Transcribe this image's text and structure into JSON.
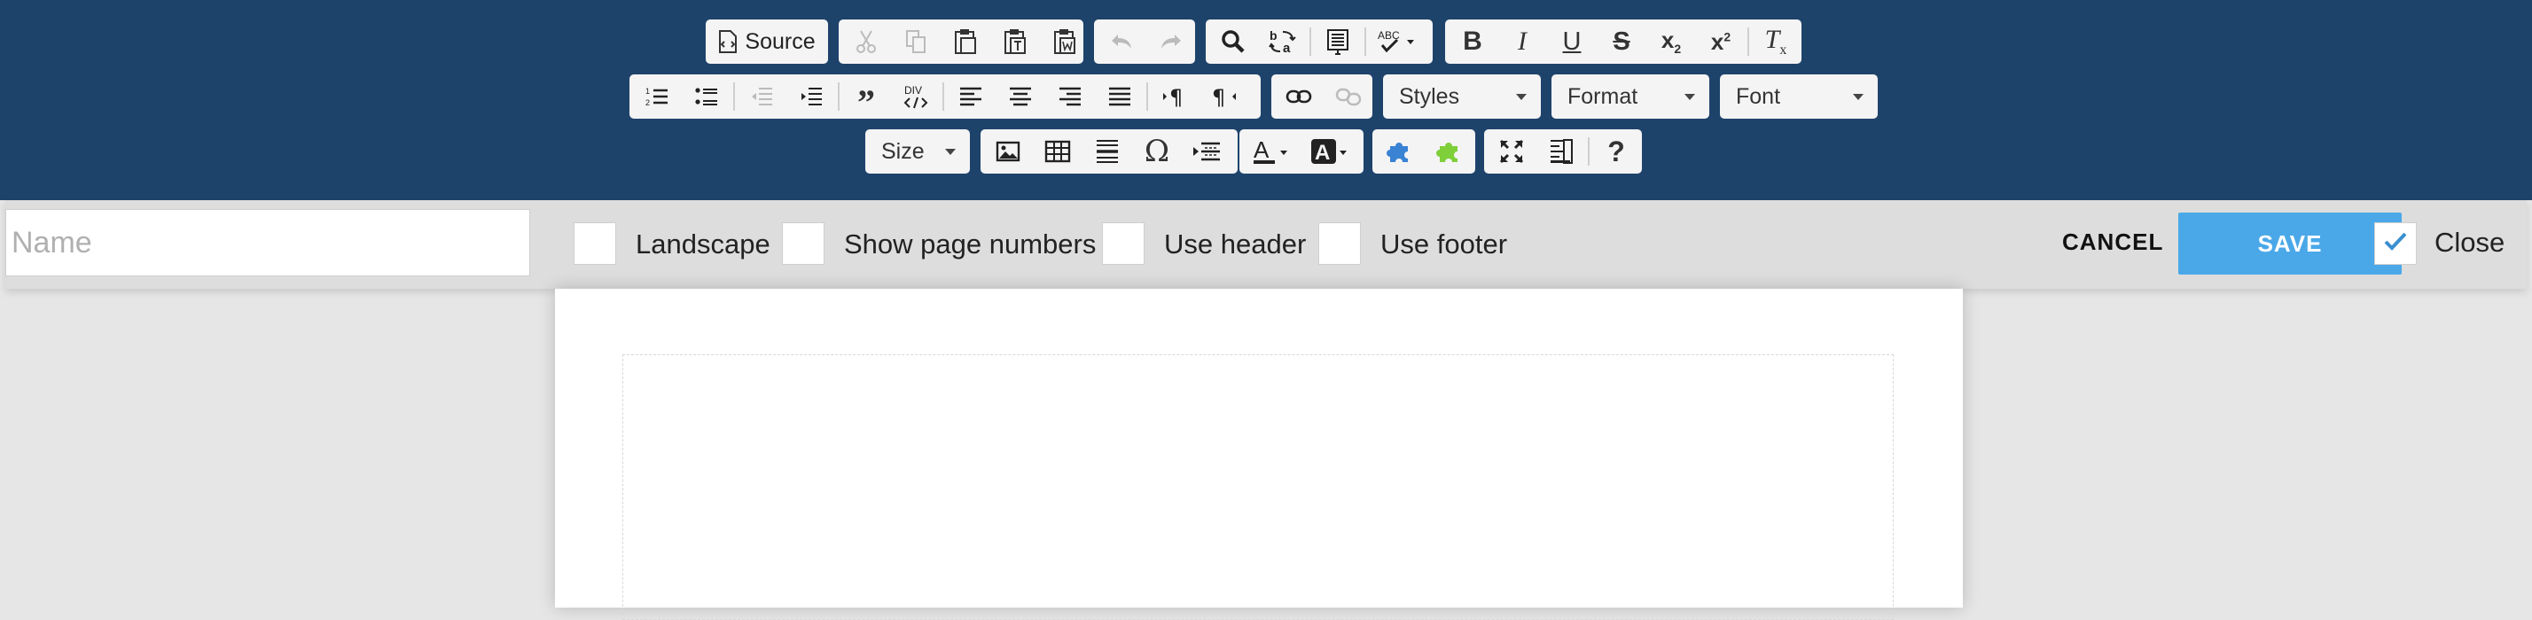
{
  "toolbar": {
    "source_label": "Source",
    "styles_label": "Styles",
    "format_label": "Format",
    "font_label": "Font",
    "size_label": "Size",
    "icons": [
      "source-icon",
      "cut-icon",
      "copy-icon",
      "paste-icon",
      "paste-text-icon",
      "paste-word-icon",
      "undo-icon",
      "redo-icon",
      "find-icon",
      "replace-icon",
      "select-all-icon",
      "spellcheck-icon",
      "bold-icon",
      "italic-icon",
      "underline-icon",
      "strikethrough-icon",
      "subscript-icon",
      "superscript-icon",
      "remove-format-icon",
      "numbered-list-icon",
      "bulleted-list-icon",
      "outdent-icon",
      "indent-icon",
      "blockquote-icon",
      "div-icon",
      "align-left-icon",
      "align-center-icon",
      "align-right-icon",
      "justify-icon",
      "ltr-icon",
      "rtl-icon",
      "link-icon",
      "unlink-icon",
      "image-icon",
      "table-icon",
      "horizontal-rule-icon",
      "special-char-icon",
      "page-break-icon",
      "text-color-icon",
      "background-color-icon",
      "plugin-blue-icon",
      "plugin-green-icon",
      "maximize-icon",
      "show-blocks-icon",
      "help-icon"
    ]
  },
  "settings": {
    "name_placeholder": "Name",
    "name_value": "",
    "landscape_label": "Landscape",
    "page_numbers_label": "Show page numbers",
    "use_header_label": "Use header",
    "use_footer_label": "Use footer",
    "cancel_label": "CANCEL",
    "save_label": "SAVE",
    "close_label": "Close",
    "close_checked": true
  },
  "colors": {
    "toolbar_bg": "#1e436b",
    "save_bg": "#4aa8e8",
    "check_blue": "#3a8fd0"
  }
}
